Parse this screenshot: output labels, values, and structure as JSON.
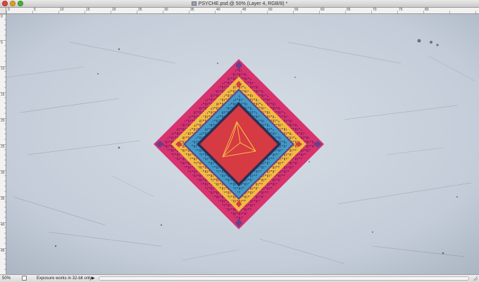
{
  "window": {
    "title": "PSYCHE.psd @ 50% (Layer 4, RGB/8) *"
  },
  "rulers": {
    "top_labels": [
      "0",
      "5",
      "10",
      "15",
      "20",
      "25",
      "30",
      "35",
      "40",
      "45",
      "50",
      "55",
      "60",
      "65",
      "70",
      "75",
      "80"
    ],
    "left_labels": [
      "0",
      "5",
      "10",
      "15",
      "20",
      "25",
      "30",
      "35",
      "40",
      "45"
    ]
  },
  "status": {
    "zoom": "50%",
    "message": "Exposure works in 32-bit only",
    "arrow": "▶"
  },
  "icons": {
    "document": "document-icon",
    "status": "status-icon",
    "resize": "resize-grip-icon"
  },
  "colors": {
    "magenta": "#d8336f",
    "yellow": "#f2bb3f",
    "blue": "#3f9cc6",
    "red": "#d63a43",
    "background": "#c5ced9"
  }
}
